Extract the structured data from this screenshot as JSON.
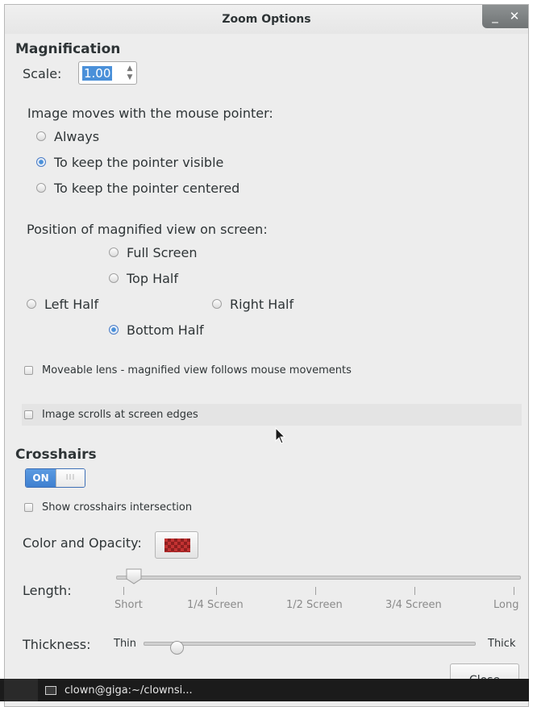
{
  "window": {
    "title": "Zoom Options",
    "minimize_glyph": "_",
    "close_glyph": "✕"
  },
  "magnification": {
    "heading": "Magnification",
    "scale_label": "Scale:",
    "scale_value": "1.00"
  },
  "mouse_tracking": {
    "heading": "Image moves with the mouse pointer:",
    "options": [
      "Always",
      "To keep the pointer visible",
      "To keep the pointer centered"
    ],
    "selected": "To keep the pointer visible"
  },
  "position": {
    "heading": "Position of magnified view on screen:",
    "full_screen": "Full Screen",
    "top_half": "Top Half",
    "left_half": "Left Half",
    "right_half": "Right Half",
    "bottom_half": "Bottom Half",
    "selected": "Bottom Half"
  },
  "options": {
    "moveable_lens": "Moveable lens - magnified view follows mouse movements",
    "screen_edges": "Image scrolls at screen edges"
  },
  "crosshairs": {
    "heading": "Crosshairs",
    "switch_on": "ON",
    "switch_off_glyph": "III",
    "show_intersection": "Show crosshairs intersection",
    "color_label": "Color and Opacity:",
    "color": "#c33232",
    "length_label": "Length:",
    "length_ticks": [
      "Short",
      "1/4 Screen",
      "1/2 Screen",
      "3/4 Screen",
      "Long"
    ],
    "length_value": "Short",
    "thickness_label": "Thickness:",
    "thickness_min": "Thin",
    "thickness_max": "Thick",
    "thickness_fraction": 0.1
  },
  "close_button": "Close",
  "taskbar": {
    "item": "clown@giga:~/clownsi..."
  },
  "colors": {
    "accent": "#4a90d9",
    "window_bg": "#ededed",
    "taskbar_bg": "#1b1b1b"
  }
}
